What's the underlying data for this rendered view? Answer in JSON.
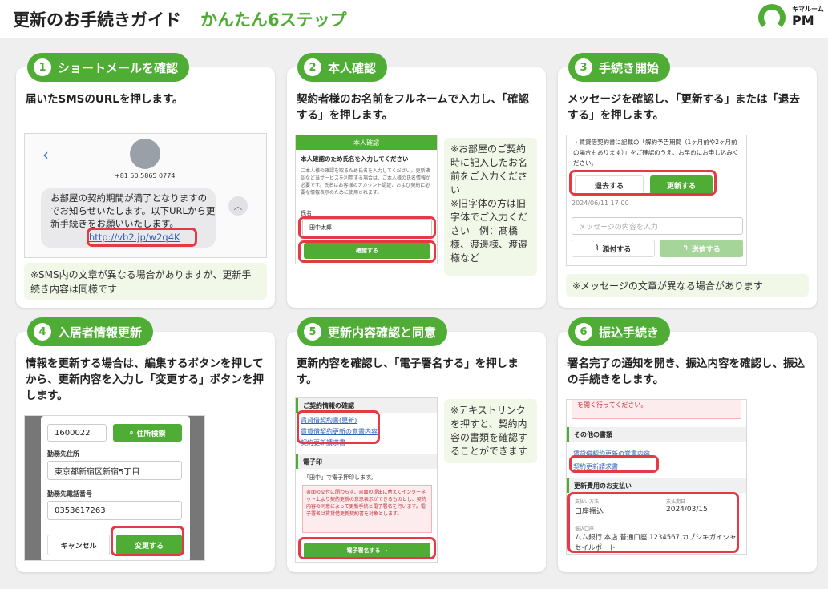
{
  "header": {
    "title_main": "更新のお手続きガイド",
    "title_accent": "かんたん6ステップ",
    "logo_small": "キマルーム",
    "logo_big": "PM"
  },
  "colors": {
    "accent": "#4fad35",
    "highlight": "#e53945",
    "link": "#3061b6"
  },
  "steps": [
    {
      "num": "1",
      "title": "ショートメールを確認",
      "desc": "届いたSMSのURLを押します。",
      "screen": {
        "phone": "+81 50 5865 0774",
        "message": "お部屋の契約期間が満了となりますのでお知らせいたします。以下URLから更新手続きをお願いいたします。",
        "link": "http://vb2.jp/w2q4K"
      },
      "note": "※SMS内の文章が異なる場合がありますが、更新手続き内容は同様です"
    },
    {
      "num": "2",
      "title": "本人確認",
      "desc": "契約者様のお名前をフルネームで入力し、「確認する」を押します。",
      "screen": {
        "header": "本人確認",
        "heading": "本人確認のため氏名を入力してください",
        "body": "ご本人様の確認を取るため氏名を入力してください。更新確認など当サービスを利用する場合は、ご本人様の氏名情報が必要です。氏名はお客様のアカウント認証、および契約に必要な情報表示のために使用されます。",
        "label": "氏名",
        "value": "田中太郎",
        "button": "確認する"
      },
      "note": "※お部屋のご契約時に記入したお名前をご入力ください\n※旧字体の方は旧字体でご入力ください　例：髙橋様、渡邊様、渡邉様など"
    },
    {
      "num": "3",
      "title": "手続き開始",
      "desc": "メッセージを確認し、「更新する」または「退去する」を押します。",
      "screen": {
        "text": "・賃貸借契約書に記載の「解約予告期間（1ヶ月前や2ヶ月前の場合もあります）」をご確認のうえ、お早めにお申し込みください。",
        "leave": "退去する",
        "renew": "更新する",
        "date": "2024/06/11 17:00",
        "placeholder": "メッセージの内容を入力",
        "attach": "添付する",
        "send": "送信する"
      },
      "note": "※メッセージの文章が異なる場合があります"
    },
    {
      "num": "4",
      "title": "入居者情報更新",
      "desc": "情報を更新する場合は、編集するボタンを押してから、更新内容を入力し「変更する」ボタンを押します。",
      "screen": {
        "zip": "1600022",
        "search": "住所検索",
        "addr_label": "勤務先住所",
        "addr": "東京都新宿区新宿5丁目",
        "tel_label": "勤務先電話番号",
        "tel": "0353617263",
        "cancel": "キャンセル",
        "change": "変更する"
      }
    },
    {
      "num": "5",
      "title": "更新内容確認と同意",
      "desc": "更新内容を確認し、「電子署名する」を押します。",
      "screen": {
        "sec1": "ご契約情報の確認",
        "links": [
          "賃貸借契約書(更新)",
          "賃貸借契約更新の覚書内容",
          "契約更新請求書"
        ],
        "sec2": "電子印",
        "stamp": "「田中」で電子押印します。",
        "warn": "書面の交付に関わらず、書面の提出に替えてインターネット上より契約更新の意思表示ができるものとし、契約内容の同意によって更新手続と電子署名を行います。電子署名は賃貸借更新契約書を対象とします。",
        "sign": "電子署名する"
      },
      "note": "※テキストリンクを押すと、契約内容の書類を確認することができます"
    },
    {
      "num": "6",
      "title": "振込手続き",
      "desc": "署名完了の通知を開き、振込内容を確認し、振込の手続きをします。",
      "screen": {
        "top": "を開く行ってください。",
        "sec1": "その他の書類",
        "link1": "賃貸借契約更新の覚書内容",
        "link2": "契約更新請求書",
        "sec2": "更新費用のお支払い",
        "method_label": "支払い方法",
        "method": "口座振込",
        "due_label": "支払期日",
        "due": "2024/03/15",
        "acct_label": "振込口座",
        "acct": "ムム銀行 本店 普通口座 1234567 カブシキガイシャセイルポート"
      }
    }
  ]
}
